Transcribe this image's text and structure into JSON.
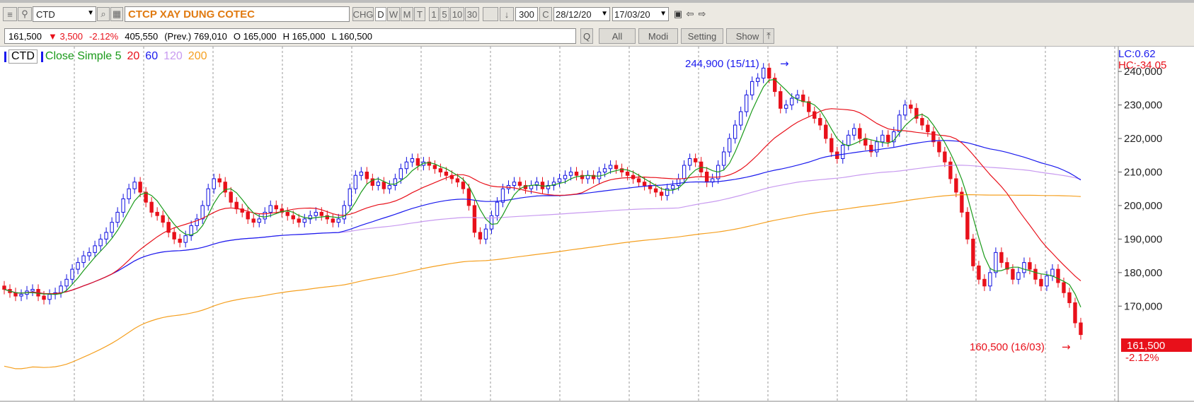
{
  "toolbar": {
    "symbol": "CTD",
    "company_name": "CTCP XAY DUNG COTEC",
    "chg_label": "CHG",
    "period_buttons": [
      "D",
      "W",
      "M",
      "T"
    ],
    "minute_buttons": [
      "1",
      "5",
      "10",
      "30"
    ],
    "bar_count": "300",
    "c_label": "C",
    "date_from": "28/12/20",
    "date_to": "17/03/20"
  },
  "info": {
    "last": "161,500",
    "change": "▼ 3,500",
    "change_pct": "-2.12%",
    "volume": "405,550",
    "prev": "(Prev.) 769,010",
    "open": "O 165,000",
    "high": "H 165,000",
    "low": "L 160,500"
  },
  "buttons": {
    "q": "Q",
    "all": "All",
    "modi": "Modi",
    "setting": "Setting",
    "show": "Show"
  },
  "legend": {
    "symbol": "CTD",
    "ma_label": "Close Simple 5",
    "ma_periods": [
      "20",
      "60",
      "120",
      "200"
    ]
  },
  "colors": {
    "up": "#1010e0",
    "down": "#e8101a",
    "ma5": "#1a9a1a",
    "ma20": "#e8101a",
    "ma60": "#1a1aee",
    "ma120": "#c89af0",
    "ma200": "#f5a020"
  },
  "chart_data": {
    "type": "candlestick",
    "x_range": [
      "28/12/20",
      "17/03/20"
    ],
    "ylim": [
      165000,
      245000
    ],
    "yticks": [
      170000,
      180000,
      190000,
      200000,
      210000,
      220000,
      230000,
      240000
    ],
    "ytick_labels": [
      "170,000",
      "180,000",
      "190,000",
      "200,000",
      "210,000",
      "220,000",
      "230,000",
      "240,000"
    ],
    "grid": true,
    "stats": {
      "lc": "LC:0.62",
      "hc": "HC:-34.05"
    },
    "last_price_label": "161,500",
    "last_change_label": "-2.12%",
    "high_annotation": "244,900 (15/11)",
    "low_annotation": "160,500 (16/03)",
    "close_series": [
      175000,
      174000,
      173000,
      173500,
      174500,
      175000,
      173000,
      172000,
      173500,
      174000,
      176000,
      178000,
      181000,
      183000,
      185000,
      186000,
      188000,
      190000,
      192000,
      195000,
      198000,
      202000,
      205000,
      207000,
      204000,
      201000,
      198000,
      197000,
      195000,
      192000,
      190000,
      189000,
      191000,
      194000,
      196000,
      200000,
      205000,
      208000,
      207000,
      204000,
      201000,
      199000,
      198000,
      196000,
      195000,
      196000,
      198000,
      200000,
      199000,
      198000,
      197000,
      196000,
      195000,
      196000,
      197000,
      198000,
      197000,
      196000,
      195000,
      196000,
      200000,
      205000,
      209000,
      210000,
      208000,
      206000,
      207000,
      205000,
      206000,
      208000,
      211000,
      213000,
      214000,
      212000,
      213000,
      212000,
      211000,
      210000,
      209000,
      208000,
      207000,
      205000,
      200000,
      192000,
      190000,
      193000,
      197000,
      201000,
      205000,
      206000,
      207000,
      206000,
      205000,
      206000,
      207000,
      205000,
      206000,
      207000,
      208000,
      209000,
      210000,
      209000,
      208000,
      209000,
      208000,
      210000,
      211000,
      212000,
      211000,
      210000,
      209000,
      208000,
      207000,
      206000,
      205000,
      204000,
      203000,
      205000,
      206000,
      208000,
      212000,
      214000,
      213000,
      210000,
      207000,
      208000,
      212000,
      216000,
      220000,
      224000,
      228000,
      233000,
      237000,
      238000,
      241000,
      238000,
      234000,
      229000,
      230000,
      232000,
      233000,
      231000,
      228000,
      226000,
      224000,
      220000,
      216000,
      214000,
      218000,
      221000,
      223000,
      220000,
      218000,
      216000,
      219000,
      221000,
      219000,
      222000,
      227000,
      230000,
      229000,
      226000,
      224000,
      222000,
      219000,
      216000,
      213000,
      208000,
      204000,
      198000,
      190000,
      182000,
      178000,
      176000,
      180000,
      186000,
      183000,
      181000,
      178000,
      180000,
      183000,
      181000,
      178000,
      176000,
      179000,
      181000,
      177000,
      174000,
      171000,
      165000,
      161500
    ]
  }
}
